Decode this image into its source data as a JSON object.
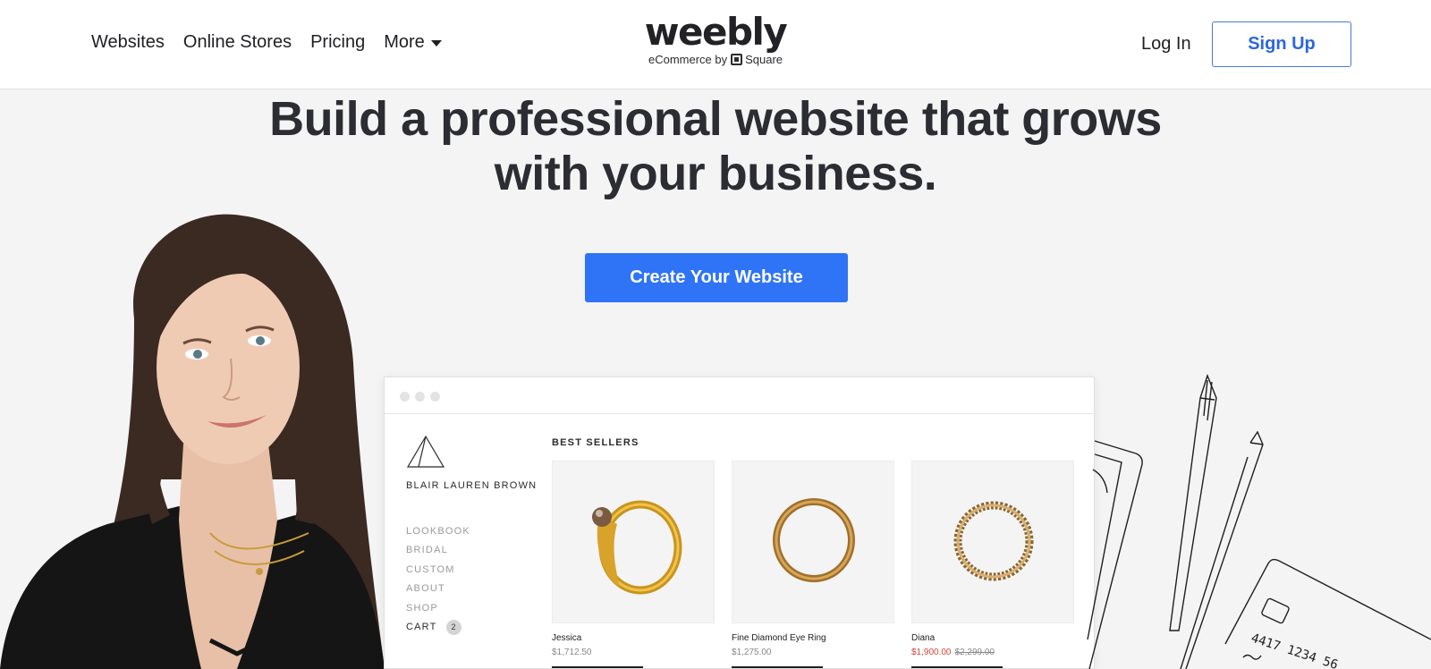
{
  "header": {
    "nav": [
      {
        "label": "Websites"
      },
      {
        "label": "Online Stores"
      },
      {
        "label": "Pricing"
      }
    ],
    "more_label": "More",
    "logo_word": "weebly",
    "logo_sub_prefix": "eCommerce by",
    "logo_sub_brand": "Square",
    "login_label": "Log In",
    "signup_label": "Sign Up"
  },
  "hero": {
    "title_line1": "Build a professional website that grows",
    "title_line2": "with your business.",
    "cta_label": "Create Your Website"
  },
  "mockup": {
    "store_name": "BLAIR LAUREN BROWN",
    "menu": [
      "LOOKBOOK",
      "BRIDAL",
      "CUSTOM",
      "ABOUT",
      "SHOP"
    ],
    "cart_label": "CART",
    "cart_count": "2",
    "section_title": "BEST SELLERS",
    "products": [
      {
        "name": "Jessica",
        "price": "$1,712.50"
      },
      {
        "name": "Fine Diamond Eye Ring",
        "price": "$1,275.00"
      },
      {
        "name": "Diana",
        "price": "$1,900.00",
        "old_price": "$2,299.00"
      }
    ]
  },
  "sketch": {
    "card_text": "4417 1234 56"
  },
  "colors": {
    "accent": "#2f74f6",
    "signup_text": "#2b67dd",
    "background": "#f4f4f4",
    "sale": "#d0453a"
  }
}
